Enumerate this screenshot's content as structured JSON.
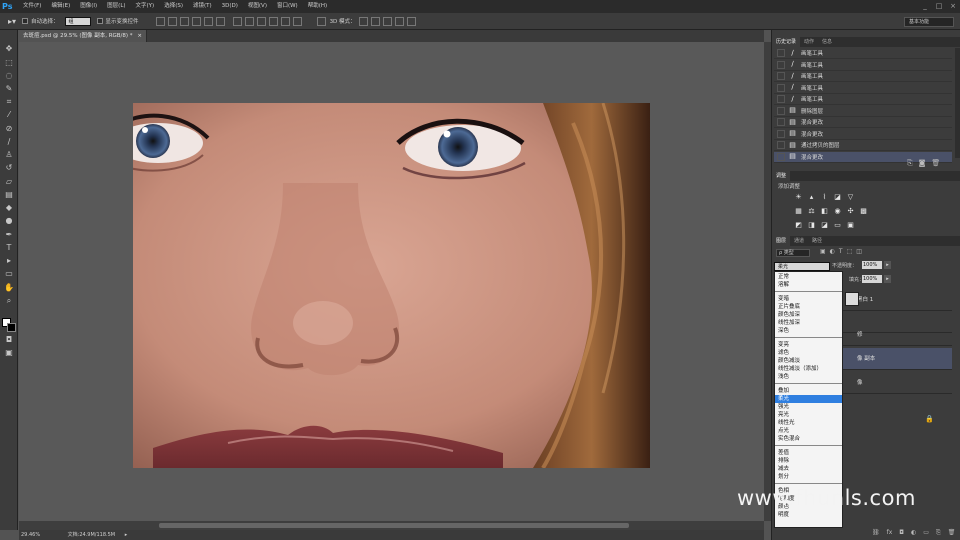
{
  "app": {
    "logo": "Ps"
  },
  "menu": [
    "文件(F)",
    "编辑(E)",
    "图像(I)",
    "图层(L)",
    "文字(Y)",
    "选择(S)",
    "滤镜(T)",
    "3D(D)",
    "视图(V)",
    "窗口(W)",
    "帮助(H)"
  ],
  "window_controls": [
    "_",
    "□",
    "×"
  ],
  "options": {
    "auto_select_label": "自动选择：",
    "auto_select_value": "组",
    "show_transform_label": "显示变换控件",
    "mode_3d_label": "3D 模式：",
    "workspace": "基本功能"
  },
  "document": {
    "tab_title": "去斑痘.psd @ 29.5% (图像 副本, RGB/8) *",
    "close": "×"
  },
  "status": {
    "zoom": "29.46%",
    "doc_info": "文档:24.9M/118.5M"
  },
  "panels": {
    "history_tabs": [
      "历史记录",
      "动作",
      "信息"
    ],
    "history_items": [
      {
        "icon": "brush-icon",
        "label": "画笔工具"
      },
      {
        "icon": "brush-icon",
        "label": "画笔工具"
      },
      {
        "icon": "brush-icon",
        "label": "画笔工具"
      },
      {
        "icon": "brush-icon",
        "label": "画笔工具"
      },
      {
        "icon": "brush-icon",
        "label": "画笔工具"
      },
      {
        "icon": "document-icon",
        "label": "删除图层"
      },
      {
        "icon": "document-icon",
        "label": "混合更改"
      },
      {
        "icon": "document-icon",
        "label": "混合更改"
      },
      {
        "icon": "document-icon",
        "label": "通过拷贝的图层"
      },
      {
        "icon": "document-icon",
        "label": "混合更改"
      }
    ],
    "adjust_tab": "调整",
    "adjust_title": "添加调整",
    "layers_tabs": [
      "图层",
      "通道",
      "路径"
    ],
    "layers_filter": "ρ 类型",
    "blend_mode": "柔光",
    "opacity_label": "不透明度：",
    "opacity_value": "100%",
    "fill_label": "填充：",
    "fill_value": "100%",
    "layer_names": [
      "黑白 1",
      "",
      "修",
      "像 副本",
      "像"
    ]
  },
  "blend_groups": [
    [
      "正常",
      "溶解"
    ],
    [
      "变暗",
      "正片叠底",
      "颜色加深",
      "线性加深",
      "深色"
    ],
    [
      "变亮",
      "滤色",
      "颜色减淡",
      "线性减淡（添加）",
      "浅色"
    ],
    [
      "叠加",
      "柔光",
      "强光",
      "亮光",
      "线性光",
      "点光",
      "实色混合"
    ],
    [
      "差值",
      "排除",
      "减去",
      "划分"
    ],
    [
      "色相",
      "饱和度",
      "颜色",
      "明度"
    ]
  ],
  "blend_highlight": "柔光",
  "watermark": "www.fhunls.com"
}
